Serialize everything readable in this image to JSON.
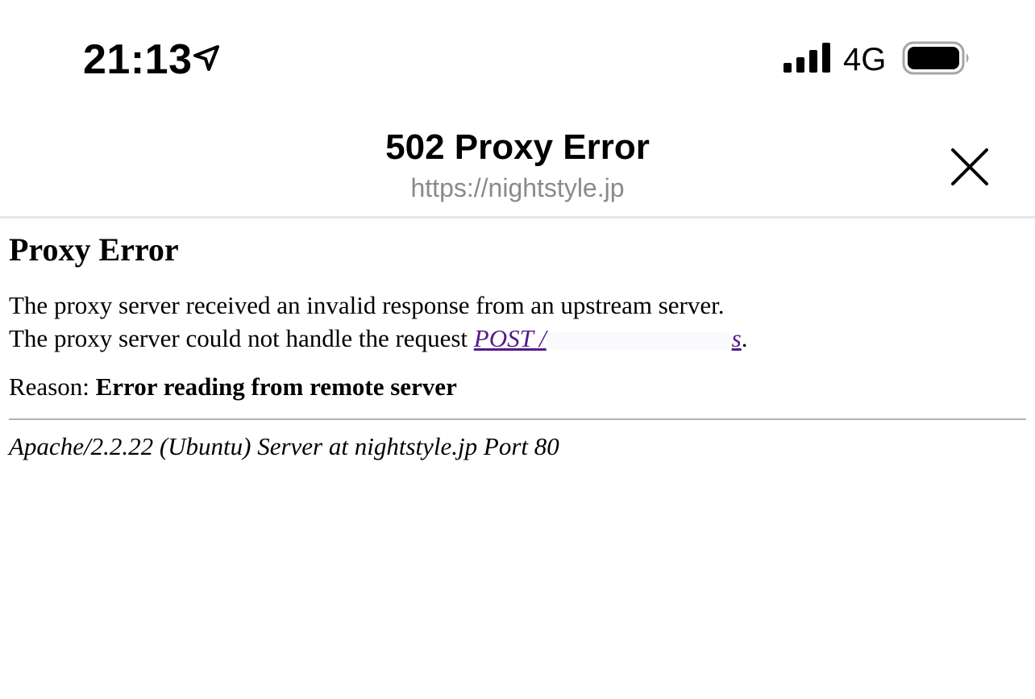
{
  "status_bar": {
    "time": "21:13",
    "network": "4G",
    "icons": [
      "location-arrow-icon",
      "signal-bars-icon",
      "battery-icon"
    ]
  },
  "header": {
    "title": "502 Proxy Error",
    "url": "https://nightstyle.jp",
    "close_icon": "close-icon"
  },
  "page": {
    "heading": "Proxy Error",
    "line1": "The proxy server received an invalid response from an upstream server.",
    "line2_prefix": "The proxy server could not handle the request ",
    "link_visible_start": "POST /",
    "link_visible_end": "s",
    "line2_suffix": ".",
    "reason_label": "Reason: ",
    "reason_text": "Error reading from remote server",
    "signature": "Apache/2.2.22 (Ubuntu) Server at nightstyle.jp Port 80"
  },
  "colors": {
    "link": "#551a8b",
    "url_gray": "#8a8a8e",
    "divider": "#e6e6e8",
    "rule": "#b3b3b3"
  }
}
